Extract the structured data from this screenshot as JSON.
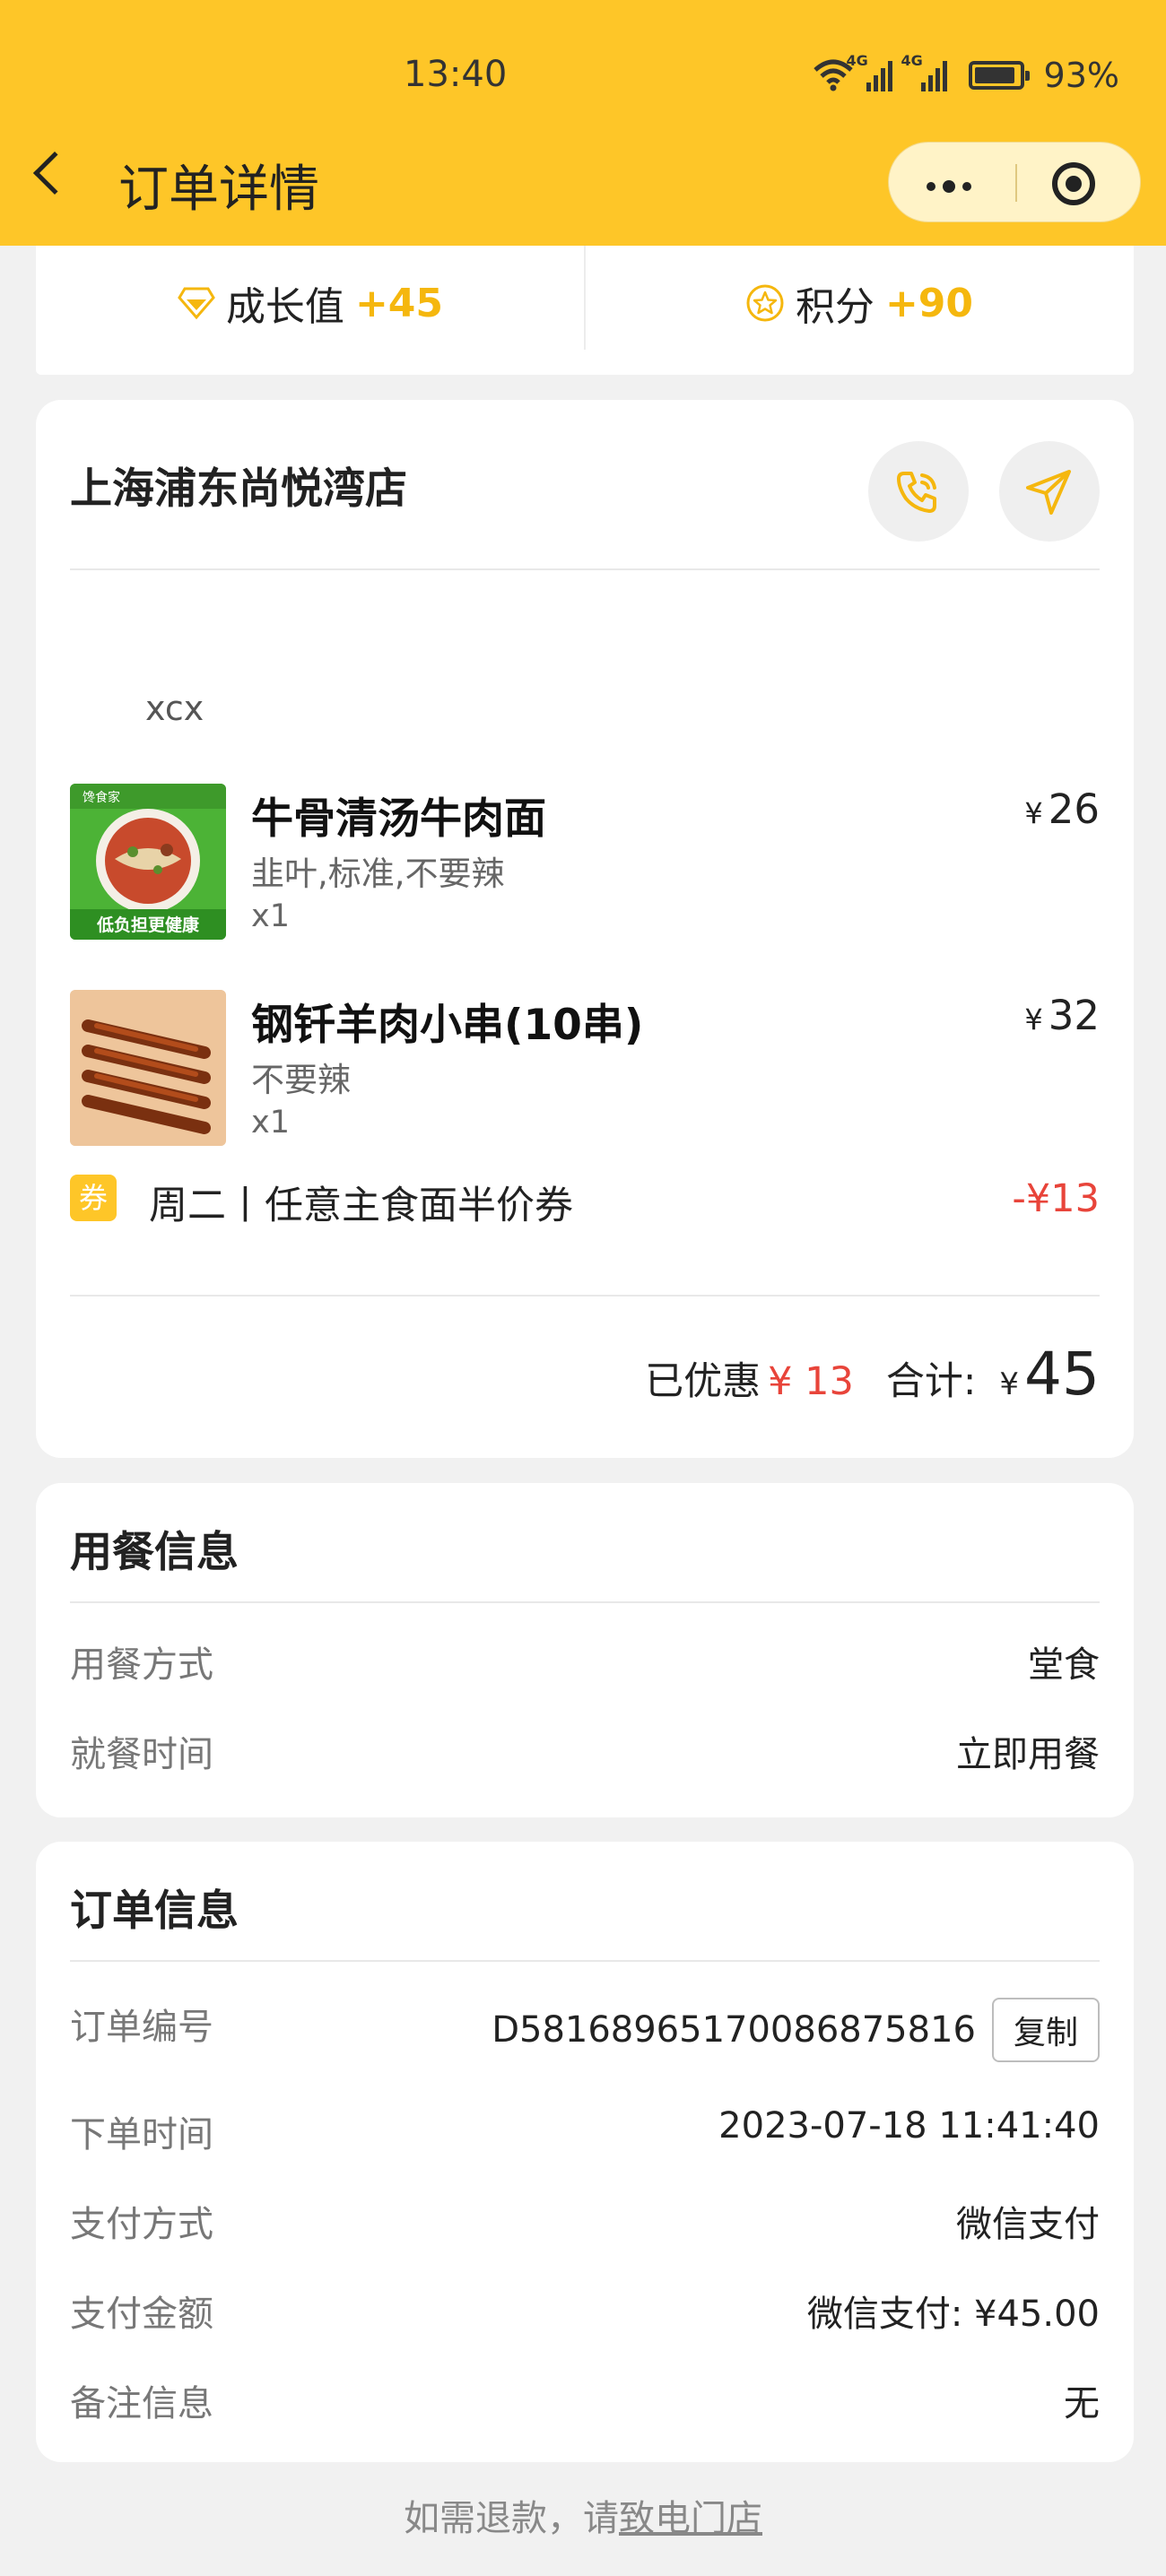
{
  "status_bar": {
    "time": "13:40",
    "network1": "4G",
    "network2": "4G",
    "battery": "93%",
    "battery_level": 0.93
  },
  "header": {
    "title": "订单详情"
  },
  "points": {
    "growth_label": "成长值",
    "growth_value": "+45",
    "score_label": "积分",
    "score_value": "+90"
  },
  "store": {
    "name": "上海浦东尚悦湾店",
    "remark": "xcx",
    "items": [
      {
        "name": "牛骨清汤牛肉面",
        "spec": "韭叶,标准,不要辣",
        "qty": "x1",
        "currency": "¥",
        "price": "26",
        "thumb_icon": "beef-noodle-photo",
        "thumb_banner": "低负担更健康"
      },
      {
        "name": "钢钎羊肉小串(10串)",
        "spec": "不要辣",
        "qty": "x1",
        "currency": "¥",
        "price": "32",
        "thumb_icon": "lamb-skewers-photo"
      }
    ],
    "coupon": {
      "tag": "券",
      "name": "周二丨任意主食面半价券",
      "value": "-¥13"
    },
    "summary": {
      "discount_label": "已优惠",
      "discount_value": "¥ 13",
      "total_label": "合计:",
      "currency": "¥",
      "total": "45"
    }
  },
  "dining": {
    "title": "用餐信息",
    "rows": [
      {
        "key": "用餐方式",
        "value": "堂食"
      },
      {
        "key": "就餐时间",
        "value": "立即用餐"
      }
    ]
  },
  "order": {
    "title": "订单信息",
    "number_key": "订单编号",
    "number_value": "D58168965170086875816",
    "copy_label": "复制",
    "rows": [
      {
        "key": "下单时间",
        "value": "2023-07-18 11:41:40"
      },
      {
        "key": "支付方式",
        "value": "微信支付"
      },
      {
        "key": "支付金额",
        "value": "微信支付: ¥45.00"
      },
      {
        "key": "备注信息",
        "value": "无"
      }
    ]
  },
  "footer": {
    "text": "如需退款，请",
    "link": "致电门店"
  },
  "colors": {
    "brand": "#FEC628",
    "accent_text": "#F5B70E",
    "discount_red": "#e8443a"
  }
}
